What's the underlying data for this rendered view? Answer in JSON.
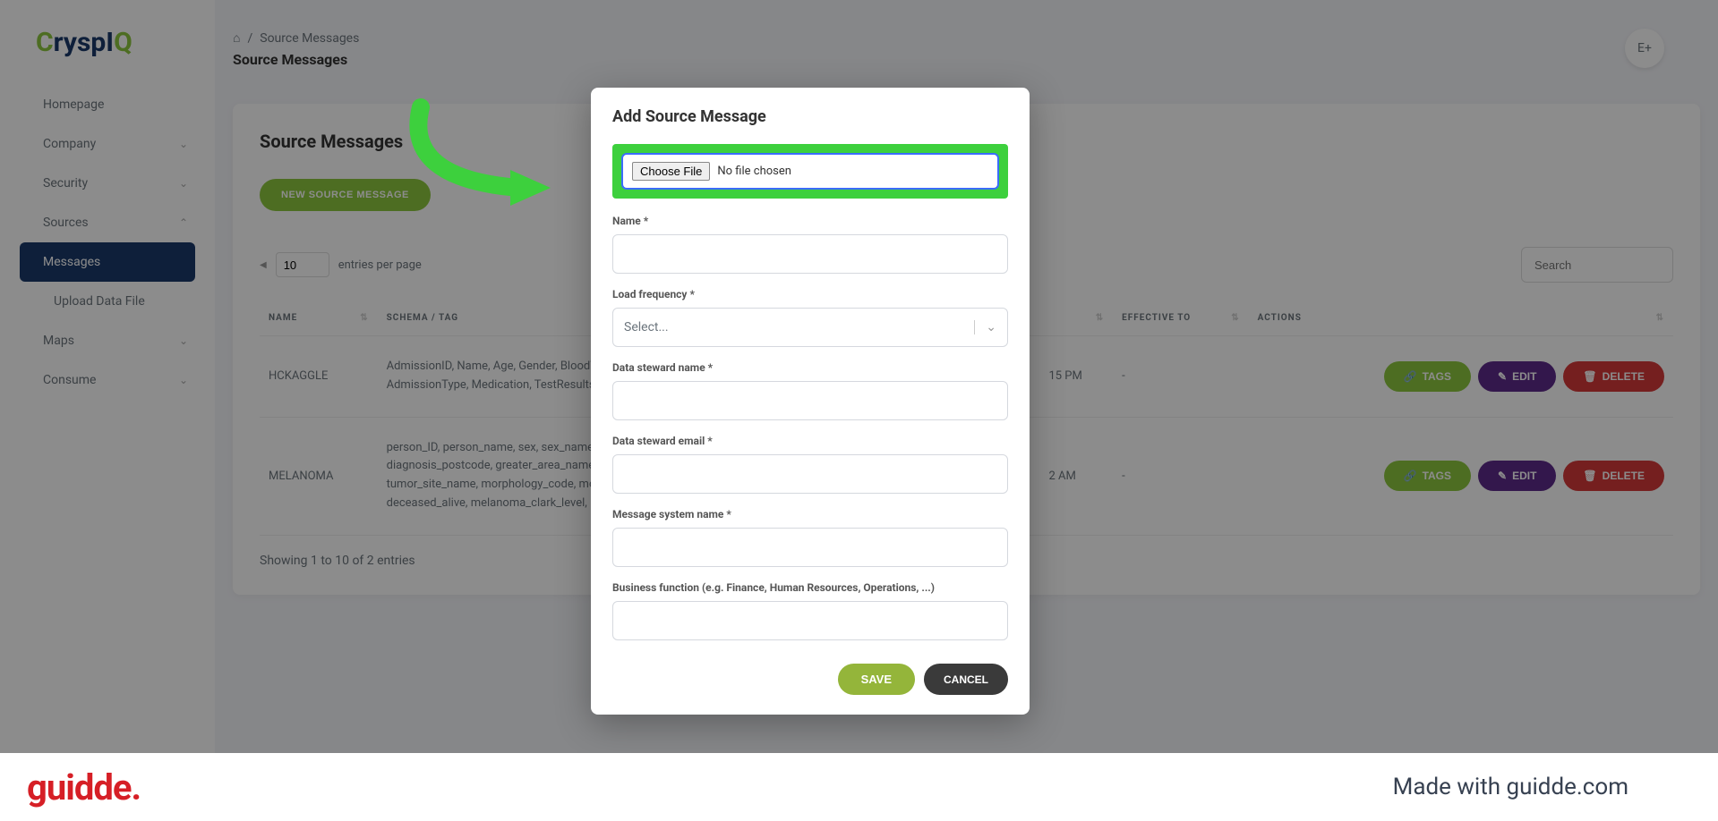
{
  "logo": {
    "c": "C",
    "rysp": "rysp",
    "i": "I",
    "q": "Q"
  },
  "sidebar": {
    "items": [
      {
        "label": "Homepage"
      },
      {
        "label": "Company"
      },
      {
        "label": "Security"
      },
      {
        "label": "Sources"
      },
      {
        "label": "Messages"
      },
      {
        "label": "Upload Data File"
      },
      {
        "label": "Maps"
      },
      {
        "label": "Consume"
      }
    ]
  },
  "breadcrumb": {
    "sep": "/",
    "source": "Source Messages"
  },
  "page_title": "Source Messages",
  "top_icon": "E+",
  "card": {
    "title": "Source Messages",
    "new_button": "NEW SOURCE MESSAGE",
    "entries_value": "10",
    "entries_label": "entries per page",
    "search_placeholder": "Search",
    "showing": "Showing 1 to 10 of 2 entries"
  },
  "columns": {
    "name": "NAME",
    "schema": "SCHEMA / TAG",
    "time": "15 PM",
    "effective": "EFFECTIVE TO",
    "actions": "ACTIONS"
  },
  "rows": [
    {
      "name": "HCKAGGLE",
      "schema": "AdmissionID, Name, Age, Gender, BloodType, DateofAdmission, Doctor, Hospital, Insurance, BillingAmount, RoomNumber, AdmissionType, Medication, TestResults",
      "time": "15 PM",
      "effective": "-"
    },
    {
      "name": "MELANOMA",
      "schema": "person_ID, person_name, sex, sex_name, aboriginal_status_name, age, age_group, country_of_birth_name, diagnosis_postcode, greater_area_name, wa_area_name, wa_area, altitude, diagnosis_year, diagnosis_date, tumor_site_name, morphology_code, morphology_prevalence, basis_of_diagnosis, basis_of_diagnosis_name, year_of_death, deceased_alive, melanoma_clark_level, melanoma_breslow_thickness, stage",
      "time": "2 AM",
      "effective": "-"
    }
  ],
  "action_labels": {
    "tags": "TAGS",
    "edit": "EDIT",
    "delete": "DELETE"
  },
  "modal": {
    "title": "Add Source Message",
    "choose_file": "Choose File",
    "no_file": "No file chosen",
    "name_label": "Name *",
    "freq_label": "Load frequency *",
    "freq_placeholder": "Select...",
    "steward_name_label": "Data steward name *",
    "steward_email_label": "Data steward email *",
    "system_name_label": "Message system name *",
    "business_label": "Business function (e.g. Finance, Human Resources, Operations, ...)",
    "save": "SAVE",
    "cancel": "CANCEL"
  },
  "footer": {
    "logo": "guidde.",
    "made": "Made with guidde.com"
  }
}
